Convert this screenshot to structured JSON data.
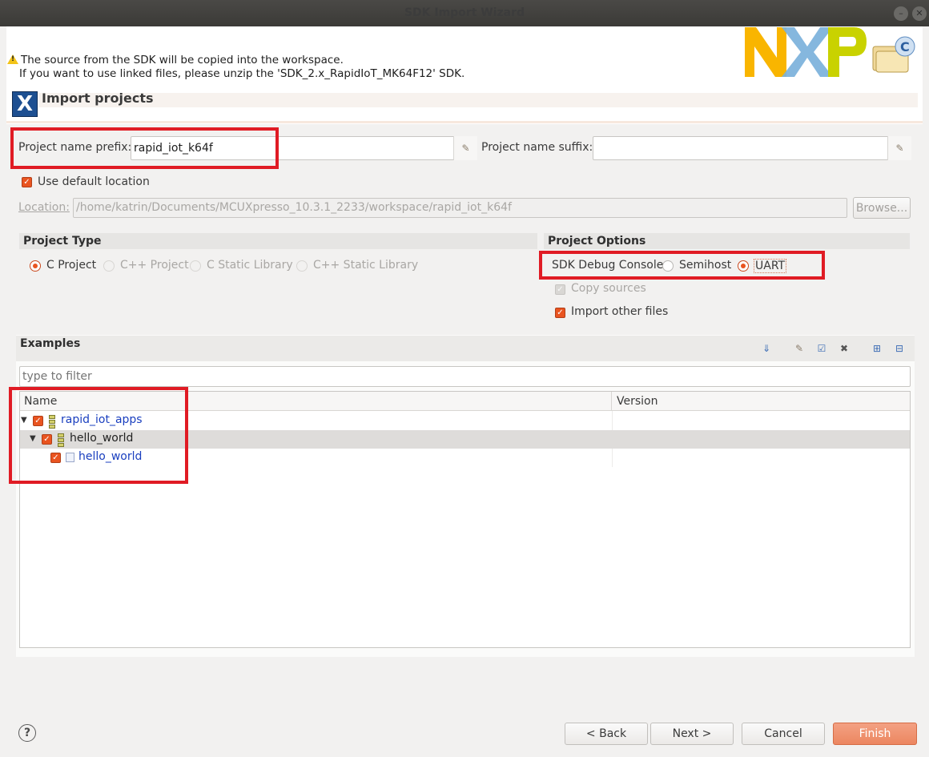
{
  "window": {
    "title": "SDK Import Wizard",
    "minimize_icon": "minimize-icon",
    "close_icon": "close-icon"
  },
  "notice": {
    "line1": "The source from the SDK will be copied into the workspace.",
    "line2": "If you want to use linked files, please unzip the 'SDK_2.x_RapidIoT_MK64F12' SDK.",
    "logo_text": "NXP",
    "logo_colors": [
      "#f9b500",
      "#7bb1db",
      "#c9d200"
    ]
  },
  "page": {
    "title": "Import projects"
  },
  "fields": {
    "prefix_label": "Project name prefix:",
    "prefix_value": "rapid_iot_k64f",
    "suffix_label": "Project name suffix:",
    "suffix_value": "",
    "use_default_location": "Use default location",
    "location_label": "Location:",
    "location_value": "/home/katrin/Documents/MCUXpresso_10.3.1_2233/workspace/rapid_iot_k64f",
    "browse": "Browse..."
  },
  "project_type": {
    "header": "Project Type",
    "options": [
      "C Project",
      "C++ Project",
      "C Static Library",
      "C++ Static Library"
    ],
    "selected": "C Project"
  },
  "project_options": {
    "header": "Project Options",
    "debug_console_label": "SDK Debug Console",
    "semihost": "Semihost",
    "uart": "UART",
    "selected": "UART",
    "copy_sources": "Copy sources",
    "import_other_files": "Import other files"
  },
  "examples": {
    "header": "Examples",
    "filter_placeholder": "type to filter",
    "columns": {
      "name": "Name",
      "version": "Version"
    },
    "rows": [
      {
        "label": "rapid_iot_apps",
        "level": 0,
        "checked": true
      },
      {
        "label": "hello_world",
        "level": 1,
        "checked": true
      },
      {
        "label": "hello_world",
        "level": 2,
        "checked": true
      }
    ]
  },
  "buttons": {
    "back": "< Back",
    "next": "Next >",
    "cancel": "Cancel",
    "finish": "Finish",
    "help": "?"
  },
  "colors": {
    "accent": "#e95420",
    "highlight_box": "#e01b24",
    "link": "#1a3fbf"
  }
}
